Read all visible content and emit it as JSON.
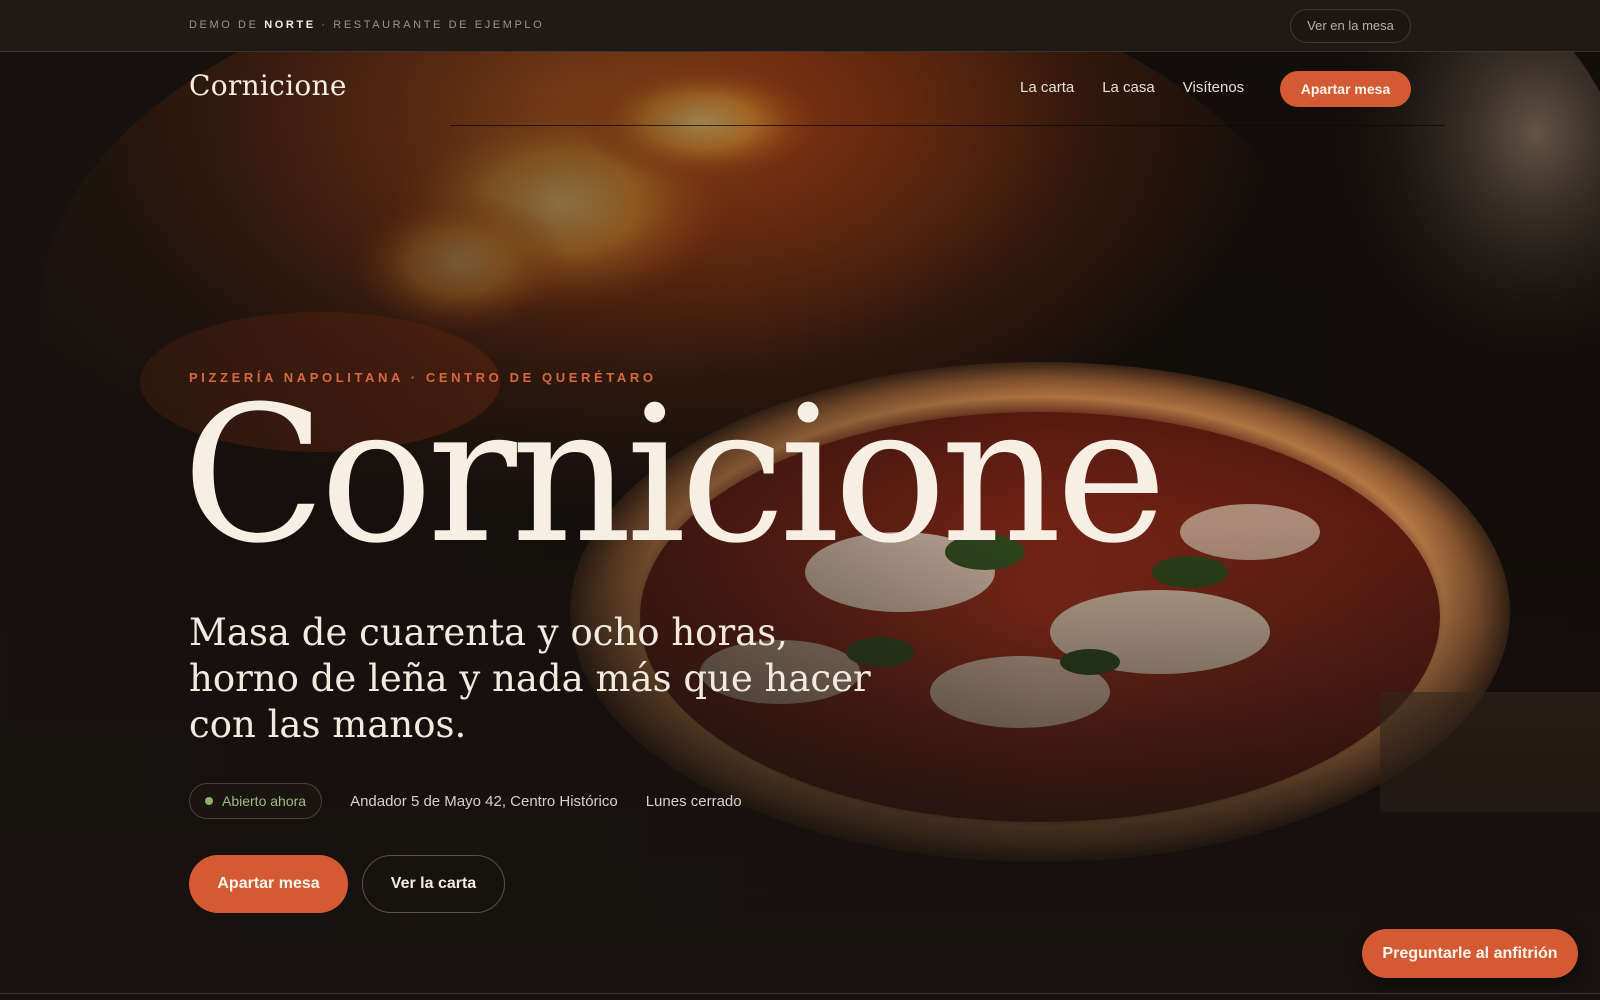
{
  "demo_bar": {
    "prefix": "DEMO DE",
    "brand": "NORTE",
    "suffix": "· RESTAURANTE DE EJEMPLO",
    "pill_label": "Ver en la mesa"
  },
  "nav": {
    "logo": "Cornicione",
    "links": [
      "La carta",
      "La casa",
      "Visítenos"
    ],
    "cta_label": "Apartar mesa"
  },
  "hero": {
    "eyebrow": "PIZZERÍA NAPOLITANA · CENTRO DE QUERÉTARO",
    "title": "Cornicione",
    "lede": "Masa de cuarenta y ocho horas, horno de leña y nada más que hacer con las manos.",
    "status": "Abierto ahora",
    "address": "Andador 5 de Mayo 42, Centro Histórico",
    "hours_note": "Lunes cerrado",
    "primary_cta": "Apartar mesa",
    "secondary_cta": "Ver la carta"
  },
  "assistant": {
    "label": "Preguntarle al anfitrión"
  },
  "colors": {
    "background": "#17120f",
    "accent": "#d45a33",
    "eyebrow": "#d8693f",
    "open_status": "#8db26a",
    "text_light": "#f7efe3"
  },
  "icons": {
    "status_indicator": "open-dot-icon"
  }
}
